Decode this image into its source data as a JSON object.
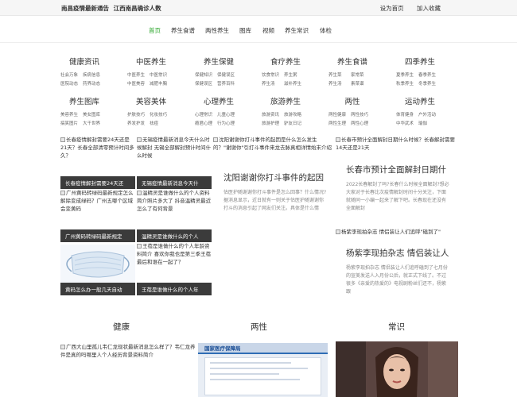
{
  "topbar": {
    "news": [
      "南昌疫情最新通告",
      "江西南昌确诊人数"
    ],
    "set_home": "设为首页",
    "bookmark": "加入收藏"
  },
  "nav": [
    "首页",
    "养生食谱",
    "两性养生",
    "图库",
    "视频",
    "养生常识",
    "体检"
  ],
  "categories": [
    {
      "title": "健康资讯",
      "subs": [
        "社会万象",
        "疾病信息",
        "医院动态",
        "药界动态"
      ]
    },
    {
      "title": "中医养生",
      "subs": [
        "中医养生",
        "中医常识",
        "中医美容",
        "减肥丰胸"
      ]
    },
    {
      "title": "养生保健",
      "subs": [
        "保健知识",
        "保健误区",
        "保健误区",
        "营养百科"
      ]
    },
    {
      "title": "食疗养生",
      "subs": [
        "饮食常识",
        "养生粥",
        "养生汤",
        "滋补养生"
      ]
    },
    {
      "title": "养生食谱",
      "subs": [
        "养生菜",
        "家常菜",
        "养生汤",
        "素菜谱"
      ]
    },
    {
      "title": "四季养生",
      "subs": [
        "夏季养生",
        "春季养生",
        "秋季养生",
        "冬季养生"
      ]
    },
    {
      "title": "养生图库",
      "subs": [
        "美容养生",
        "美女图库",
        "搞笑图片",
        "大千世界"
      ]
    },
    {
      "title": "美容美体",
      "subs": [
        "护肤技巧",
        "化妆技巧",
        "养发护发",
        "祛痘"
      ]
    },
    {
      "title": "心理养生",
      "subs": [
        "心理常识",
        "儿童心理",
        "瘾君心理",
        "行为心理"
      ]
    },
    {
      "title": "旅游养生",
      "subs": [
        "旅游资讯",
        "旅游攻略",
        "旅游护理",
        "驴友日记"
      ]
    },
    {
      "title": "两性",
      "subs": [
        "两性健康",
        "两性技巧",
        "两性生理",
        "两性心理"
      ]
    },
    {
      "title": "运动养生",
      "subs": [
        "体育健身",
        "户外活动",
        "中华武术",
        "瑜伽"
      ]
    }
  ],
  "grid": [
    {
      "alt": "长春疫情解封需要24天还是21天？长春全部清零预计时间多久？",
      "caption": "长春疫情解封需要24天还"
    },
    {
      "alt": "无锡疫情最新消息今天什么时候解封 无锡全部解封预计时间什么时候",
      "caption": "无锡疫情最新消息今天什"
    },
    {
      "alt": "广州黄码转绿码最新规定怎么解除变成绿码？广州五哪个区域会变黄码",
      "caption": "广州黄码转绿码最新规定"
    },
    {
      "alt": "温精灵是谁做什么的个人资料简介照片多大了 抖音温精灵最近怎么了有何背景",
      "caption": "温精灵是谁做什么的个人"
    },
    {
      "alt": "",
      "caption": "黄码怎么办一般几天自动"
    },
    {
      "alt": "王蓓是谁做什么的个人年龄资料简介 喜欢你我也是第三季王蓓最后和谁在一起了？",
      "caption": "王蓓是谁做什么的个人年"
    }
  ],
  "feature1": {
    "img_alt": "沈阳谢谢你打斗事件的起因是什么怎么发生的？\"谢谢你\"引打斗事件来龙去脉真相详情始末介绍",
    "title": "沈阳谢谢你打斗事件的起因",
    "desc": "估医护随谢谢你打斗事件是怎么回事？什么情况?据消息显示，近日就有一则关于估医护随谢谢你打斗的消息引起了网友们关注。具体是什么情"
  },
  "feature2": {
    "img_alt": "长春市预计全面解封日期什么时候？长春解封需要14天还是21天",
    "title": "长春市预计全面解封日期什",
    "desc": "2022长春解封了吗?长春什么时候全面解封?想必大家对于长春比次疫情解封时间十分关注，下面就随同一小编一起来了解下吧。长春现在还没有全面解封"
  },
  "feature3": {
    "img_alt": "杨紫李现拍杂志 情侣装让人们追呼\"磕到了\"",
    "title": "杨紫李现拍杂志 情侣装让人",
    "desc": "杨紫李现拍杂志 情侣装让人们追呼磕到了七月份的宣美发送人入月份公后，就正式下线了。不过很多《亲爱的热爱的》电视剧粉丝们还不，杨紫跟"
  },
  "sections": [
    "健康",
    "两性",
    "常识"
  ],
  "bottom": {
    "alt": "广西大山里孤儿韦仁龙现状最新消息怎么样了？韦仁龙养件是真的吗哪里人个人经历背景资料简介",
    "site_header": "国家医疗保障局"
  }
}
